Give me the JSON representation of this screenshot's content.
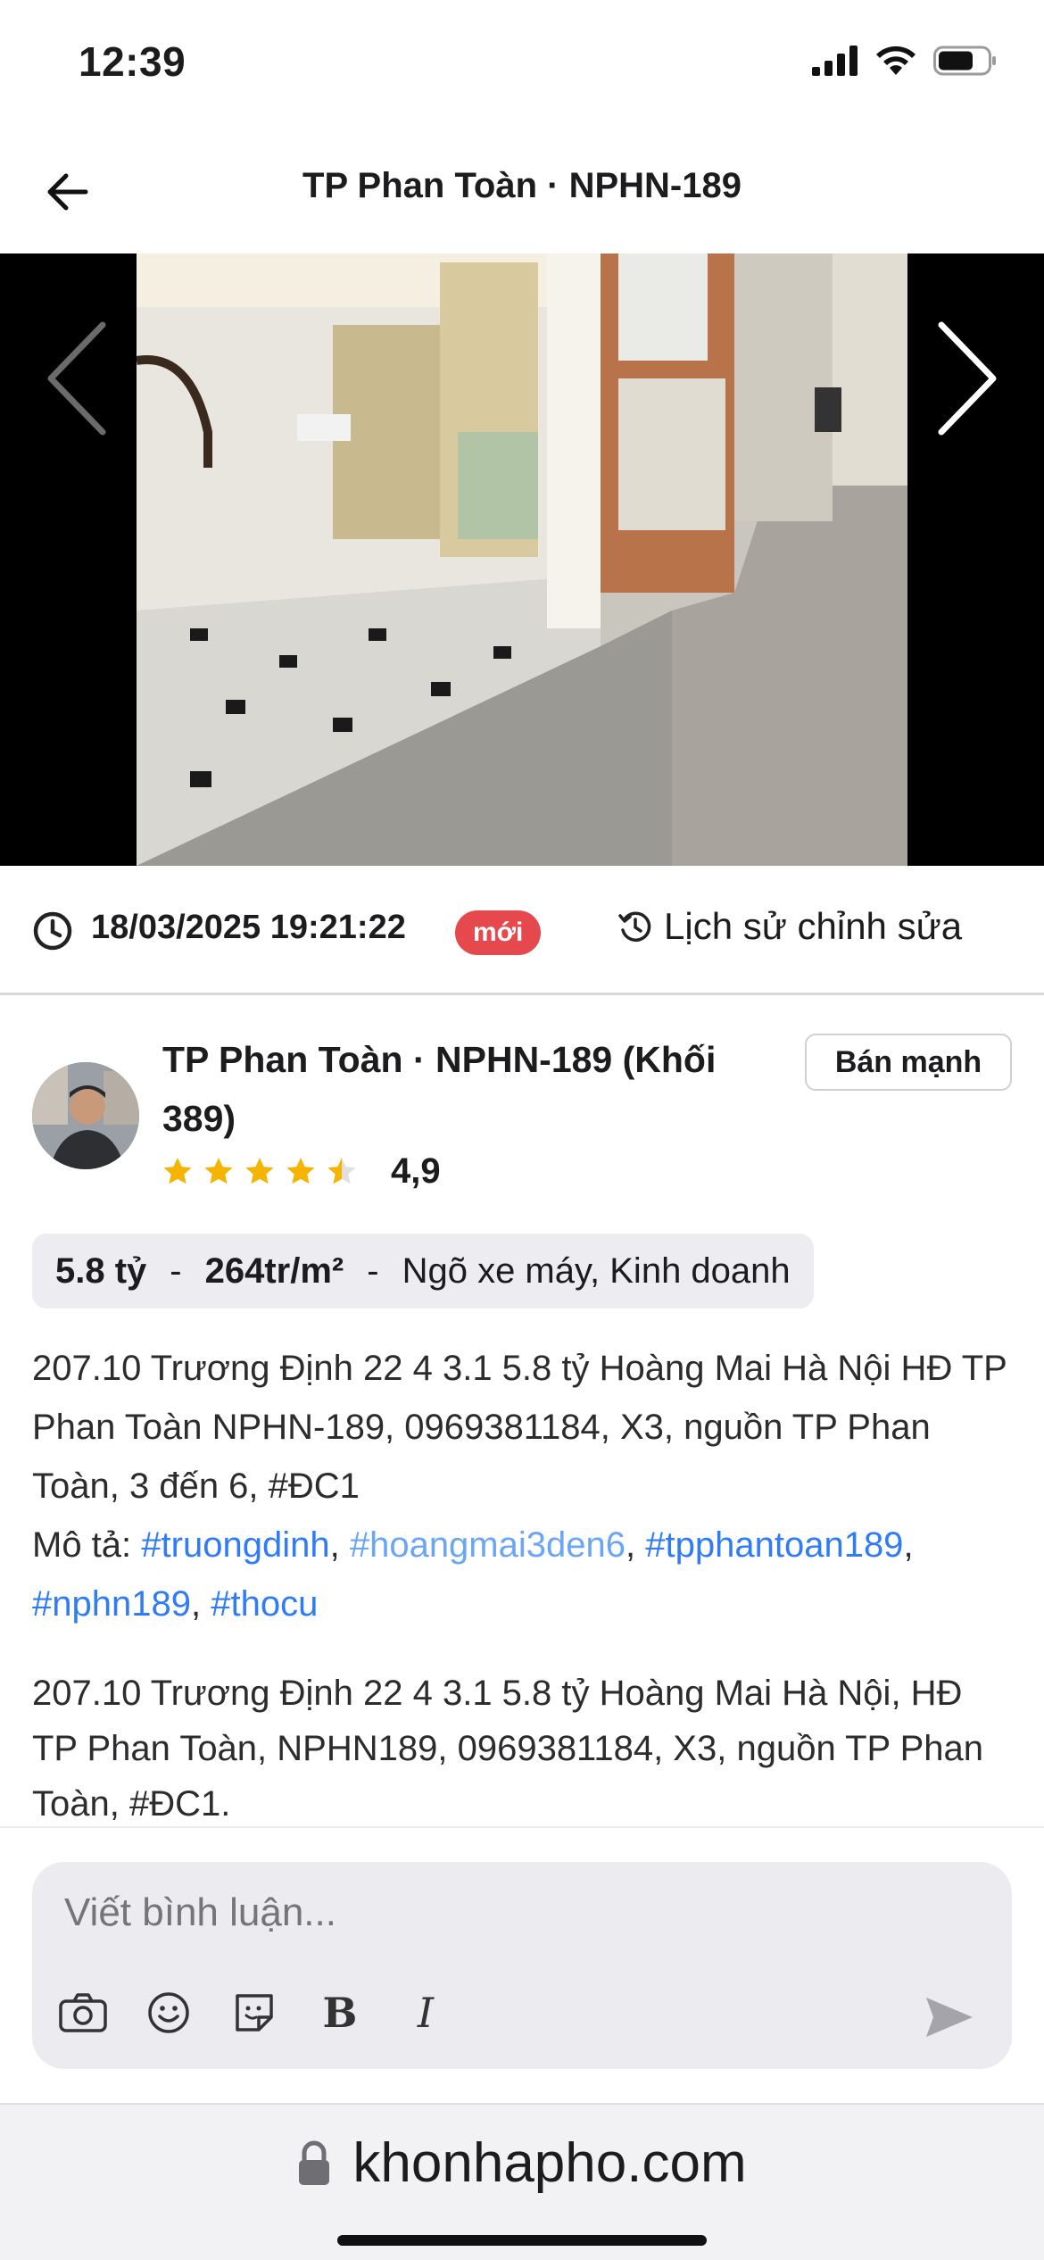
{
  "status_bar": {
    "time": "12:39"
  },
  "header": {
    "title": "TP Phan Toàn · NPHN-189"
  },
  "meta": {
    "date": "18/03/2025 19:21:22",
    "badge": "mới",
    "history_label": "Lịch sử chỉnh sửa"
  },
  "seller": {
    "name": "TP Phan Toàn · NPHN-189 (Khối 389)",
    "rating": "4,9",
    "tag": "Bán mạnh"
  },
  "price": {
    "total": "5.8 tỷ",
    "separator": "-",
    "per_m2": "264tr/m²",
    "features": "Ngõ xe máy, Kinh doanh"
  },
  "description": {
    "line1": "207.10 Trương Định 22 4 3.1 5.8 tỷ Hoàng Mai Hà Nội HĐ TP Phan Toàn NPHN-189, 0969381184, X3, nguồn TP Phan Toàn, 3 đến 6, #ĐC1",
    "mo_ta_label": "Mô tả:",
    "hashtags": [
      "#truongdinh",
      "#hoangmai3den6",
      "#tpphantoan189",
      "#nphn189",
      "#thocu"
    ],
    "comma": ",",
    "line2": "207.10 Trương Định 22 4 3.1 5.8 tỷ Hoàng Mai Hà Nội, HĐ TP Phan Toàn, NPHN189, 0969381184, X3, nguồn TP Phan Toàn, #ĐC1."
  },
  "composer": {
    "placeholder": "Viết bình luận...",
    "tools": [
      "camera-icon",
      "emoji-icon",
      "sticker-icon",
      "bold-icon",
      "italic-icon"
    ],
    "bold_glyph": "B",
    "italic_glyph": "I"
  },
  "browser": {
    "url": "khonhapho.com"
  },
  "colors": {
    "hashtag": "#2f7cf6",
    "badge": "#e5484d",
    "star": "#f4b400"
  }
}
